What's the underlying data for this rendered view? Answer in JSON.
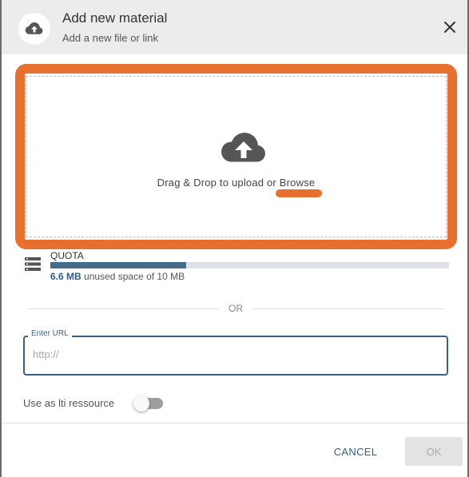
{
  "header": {
    "title": "Add new material",
    "subtitle": "Add a new file or link",
    "icon": "cloud-upload-icon",
    "close_icon": "close-icon"
  },
  "dropzone": {
    "icon": "cloud-upload-icon",
    "text": "Drag & Drop to upload or ",
    "browse_label": "Browse",
    "highlight_color": "#e8702f"
  },
  "quota": {
    "icon": "storage-icon",
    "title": "QUOTA",
    "used_label": "6.6 MB",
    "rest_label": " unused space of 10 MB",
    "fraction": 0.34
  },
  "divider": {
    "label": "OR"
  },
  "url": {
    "label": "Enter URL",
    "placeholder": "http://",
    "value": ""
  },
  "lti": {
    "label": "Use as lti ressource",
    "enabled": false
  },
  "footer": {
    "cancel_label": "CANCEL",
    "ok_label": "OK"
  },
  "colors": {
    "accent": "#3d5f7e",
    "quota_fill": "#456b8a",
    "annotation": "#e8702f"
  }
}
